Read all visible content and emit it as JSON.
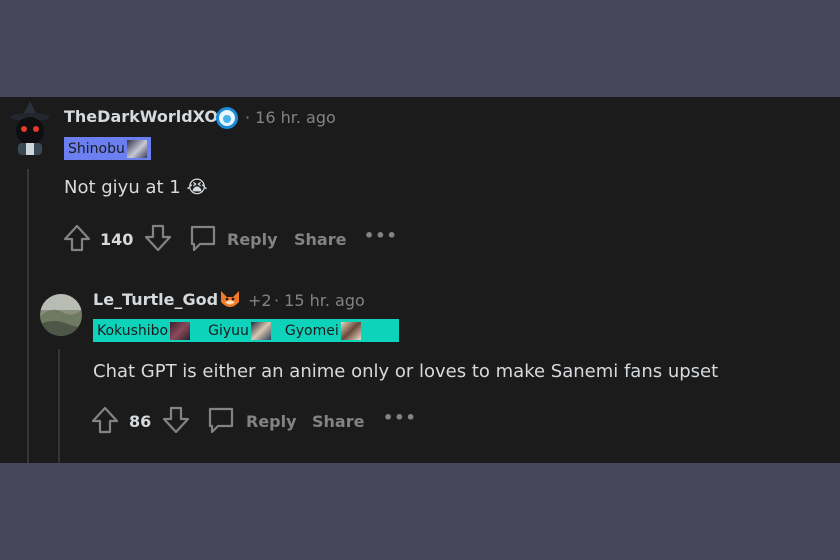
{
  "comments": [
    {
      "username": "TheDarkWorldXO",
      "timestamp": "· 16 hr. ago",
      "flair": [
        {
          "label": "Shinobu"
        }
      ],
      "flair_color": "#6b7ff0",
      "text": "Not giyu at 1",
      "emoji": "😭",
      "votes": "140",
      "reply_label": "Reply",
      "share_label": "Share",
      "more_label": "•••",
      "avatar_icon": "witch-hat-avatar-icon",
      "badge_icon": "award-badge-icon"
    },
    {
      "username": "Le_Turtle_God",
      "award_extra": "+2",
      "timestamp": "· 15 hr. ago",
      "flair": [
        {
          "label": "Kokushibo"
        },
        {
          "label": "Giyuu"
        },
        {
          "label": "Gyomei"
        }
      ],
      "flair_color": "#0dd3bb",
      "text": "Chat GPT is either an anime only or loves to make Sanemi fans upset",
      "votes": "86",
      "reply_label": "Reply",
      "share_label": "Share",
      "more_label": "•••",
      "avatar_icon": "landscape-avatar-icon",
      "badge_icon": "fox-award-icon"
    }
  ],
  "colors": {
    "background": "#48465a",
    "panel": "#1b1b1c",
    "text": "#d7dadc",
    "muted": "#818384"
  }
}
